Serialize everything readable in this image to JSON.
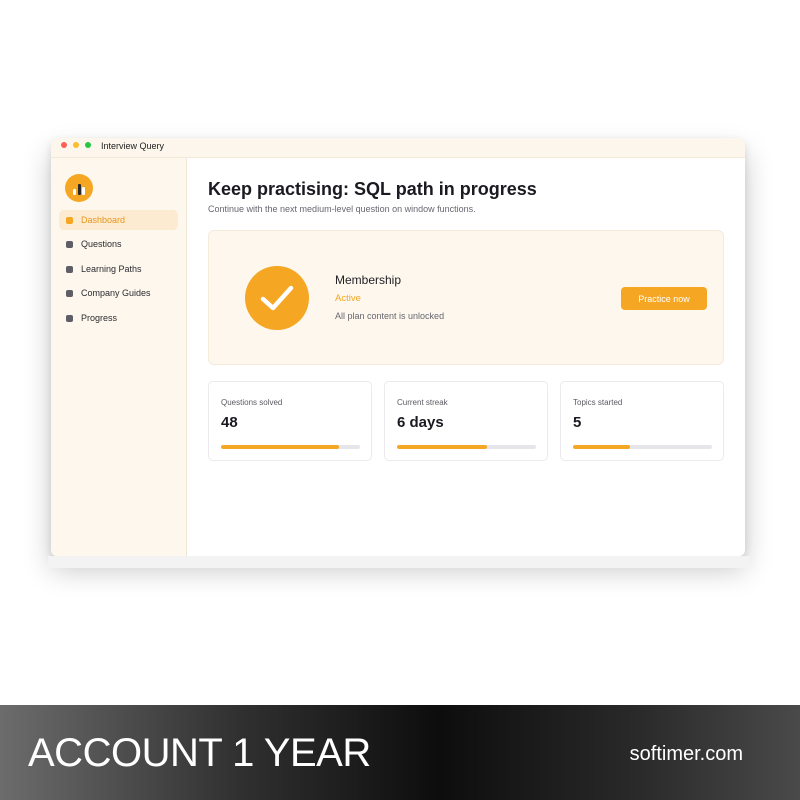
{
  "window": {
    "title": "Interview Query"
  },
  "sidebar": {
    "items": [
      {
        "label": "Dashboard",
        "active": true
      },
      {
        "label": "Questions",
        "active": false
      },
      {
        "label": "Learning Paths",
        "active": false
      },
      {
        "label": "Company Guides",
        "active": false
      },
      {
        "label": "Progress",
        "active": false
      }
    ]
  },
  "main": {
    "headline": "Keep practising: SQL path in progress",
    "subline": "Continue with the next medium-level question on window functions.",
    "membership": {
      "title": "Membership",
      "status": "Active",
      "description": "All plan content is unlocked",
      "button_label": "Practice now",
      "icon": "checkmark-icon"
    },
    "stats": [
      {
        "label": "Questions solved",
        "value": "48",
        "progress": 0.85
      },
      {
        "label": "Current streak",
        "value": "6 days",
        "progress": 0.65
      },
      {
        "label": "Topics started",
        "value": "5",
        "progress": 0.41
      }
    ]
  },
  "banner": {
    "title": "ACCOUNT 1 YEAR",
    "site": "softimer.com"
  },
  "colors": {
    "accent": "#f5a623",
    "sidebar_bg": "#fdf7ed",
    "active_item_bg": "#fcebd0"
  }
}
